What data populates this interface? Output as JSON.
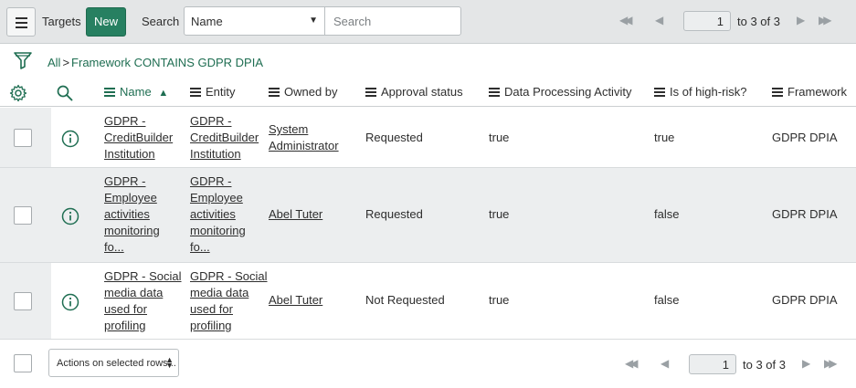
{
  "topbar": {
    "targets_label": "Targets",
    "new_label": "New",
    "search_label": "Search",
    "search_field_selected": "Name",
    "search_placeholder": "Search",
    "page_value": "1",
    "page_text": "to 3 of 3"
  },
  "breadcrumb": {
    "root": "All",
    "separator": ">",
    "condition": "Framework CONTAINS GDPR DPIA"
  },
  "columns": {
    "name": "Name",
    "entity": "Entity",
    "owned_by": "Owned by",
    "approval_status": "Approval status",
    "data_processing_activity": "Data Processing Activity",
    "is_high_risk": "Is of high-risk?",
    "framework": "Framework"
  },
  "rows": [
    {
      "name_lines": [
        "GDPR -",
        "CreditBuilder",
        "Institution"
      ],
      "entity_lines": [
        "GDPR -",
        "CreditBuilder",
        "Institution"
      ],
      "owned_by_lines": [
        "System",
        "Administrator"
      ],
      "approval_status": "Requested",
      "data_processing_activity": "true",
      "is_high_risk": "true",
      "framework": "GDPR DPIA"
    },
    {
      "name_lines": [
        "GDPR -",
        "Employee",
        "activities",
        "monitoring",
        "fo..."
      ],
      "entity_lines": [
        "GDPR -",
        "Employee",
        "activities",
        "monitoring",
        "fo..."
      ],
      "owned_by_lines": [
        "Abel Tuter"
      ],
      "approval_status": "Requested",
      "data_processing_activity": "true",
      "is_high_risk": "false",
      "framework": "GDPR DPIA"
    },
    {
      "name_lines": [
        "GDPR - Social",
        "media data",
        "used for",
        "profiling"
      ],
      "entity_lines": [
        "GDPR - Social",
        "media data",
        "used for",
        "profiling"
      ],
      "owned_by_lines": [
        "Abel Tuter"
      ],
      "approval_status": "Not Requested",
      "data_processing_activity": "true",
      "is_high_risk": "false",
      "framework": "GDPR DPIA"
    }
  ],
  "footer": {
    "actions_label": "Actions on selected rows...",
    "page_value": "1",
    "page_text": "to 3 of 3"
  },
  "colors": {
    "accent": "#278061",
    "link_green": "#1f6e52",
    "row_alt": "#eceeef"
  }
}
